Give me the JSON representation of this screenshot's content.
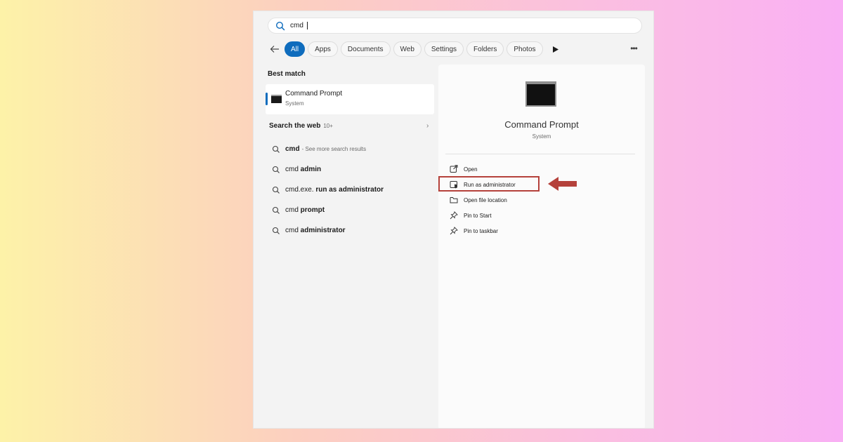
{
  "search": {
    "value": "cmd",
    "placeholder": ""
  },
  "tabs": [
    {
      "label": "All",
      "active": true
    },
    {
      "label": "Apps"
    },
    {
      "label": "Documents"
    },
    {
      "label": "Web"
    },
    {
      "label": "Settings"
    },
    {
      "label": "Folders"
    },
    {
      "label": "Photos"
    }
  ],
  "best_match": {
    "heading": "Best match",
    "title": "Command Prompt",
    "subtitle": "System"
  },
  "web": {
    "heading": "Search the web",
    "count": "10+",
    "items": [
      {
        "bold": "cmd",
        "hint": "- See more search results"
      },
      {
        "prefix": "cmd ",
        "bold": "admin"
      },
      {
        "prefix": "cmd.exe. ",
        "bold": "run as administrator"
      },
      {
        "prefix": "cmd ",
        "bold": "prompt"
      },
      {
        "prefix": "cmd ",
        "bold": "administrator"
      }
    ]
  },
  "detail": {
    "title": "Command Prompt",
    "subtitle": "System",
    "actions": [
      {
        "label": "Open",
        "icon": "open-external-icon"
      },
      {
        "label": "Run as administrator",
        "icon": "shield-admin-icon"
      },
      {
        "label": "Open file location",
        "icon": "folder-icon"
      },
      {
        "label": "Pin to Start",
        "icon": "pin-icon"
      },
      {
        "label": "Pin to taskbar",
        "icon": "pin-icon"
      }
    ]
  },
  "colors": {
    "accent": "#0f6cbd",
    "highlight": "#b5413b"
  }
}
